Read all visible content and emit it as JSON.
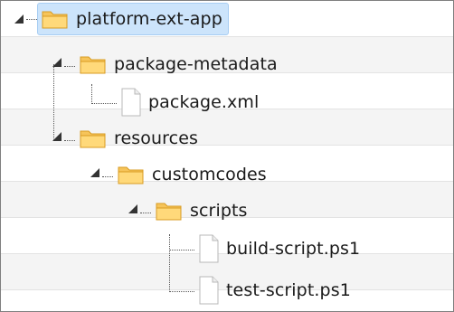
{
  "tree": {
    "nodes": [
      {
        "label": "platform-ext-app",
        "type": "folder",
        "state": "expanded",
        "selected": true
      },
      {
        "label": "package-metadata",
        "type": "folder",
        "state": "expanded"
      },
      {
        "label": "package.xml",
        "type": "file"
      },
      {
        "label": "resources",
        "type": "folder",
        "state": "expanded"
      },
      {
        "label": "customcodes",
        "type": "folder",
        "state": "expanded"
      },
      {
        "label": "scripts",
        "type": "folder",
        "state": "expanded"
      },
      {
        "label": "build-script.ps1",
        "type": "file"
      },
      {
        "label": "test-script.ps1",
        "type": "file"
      }
    ]
  },
  "icons": {
    "folder": "folder-icon",
    "file": "file-icon",
    "expander": "expanded-triangle-icon"
  },
  "colors": {
    "selection_bg": "#cce4fb",
    "folder_fill": "#f7c65d",
    "row_alt": "#f4f4f4"
  }
}
